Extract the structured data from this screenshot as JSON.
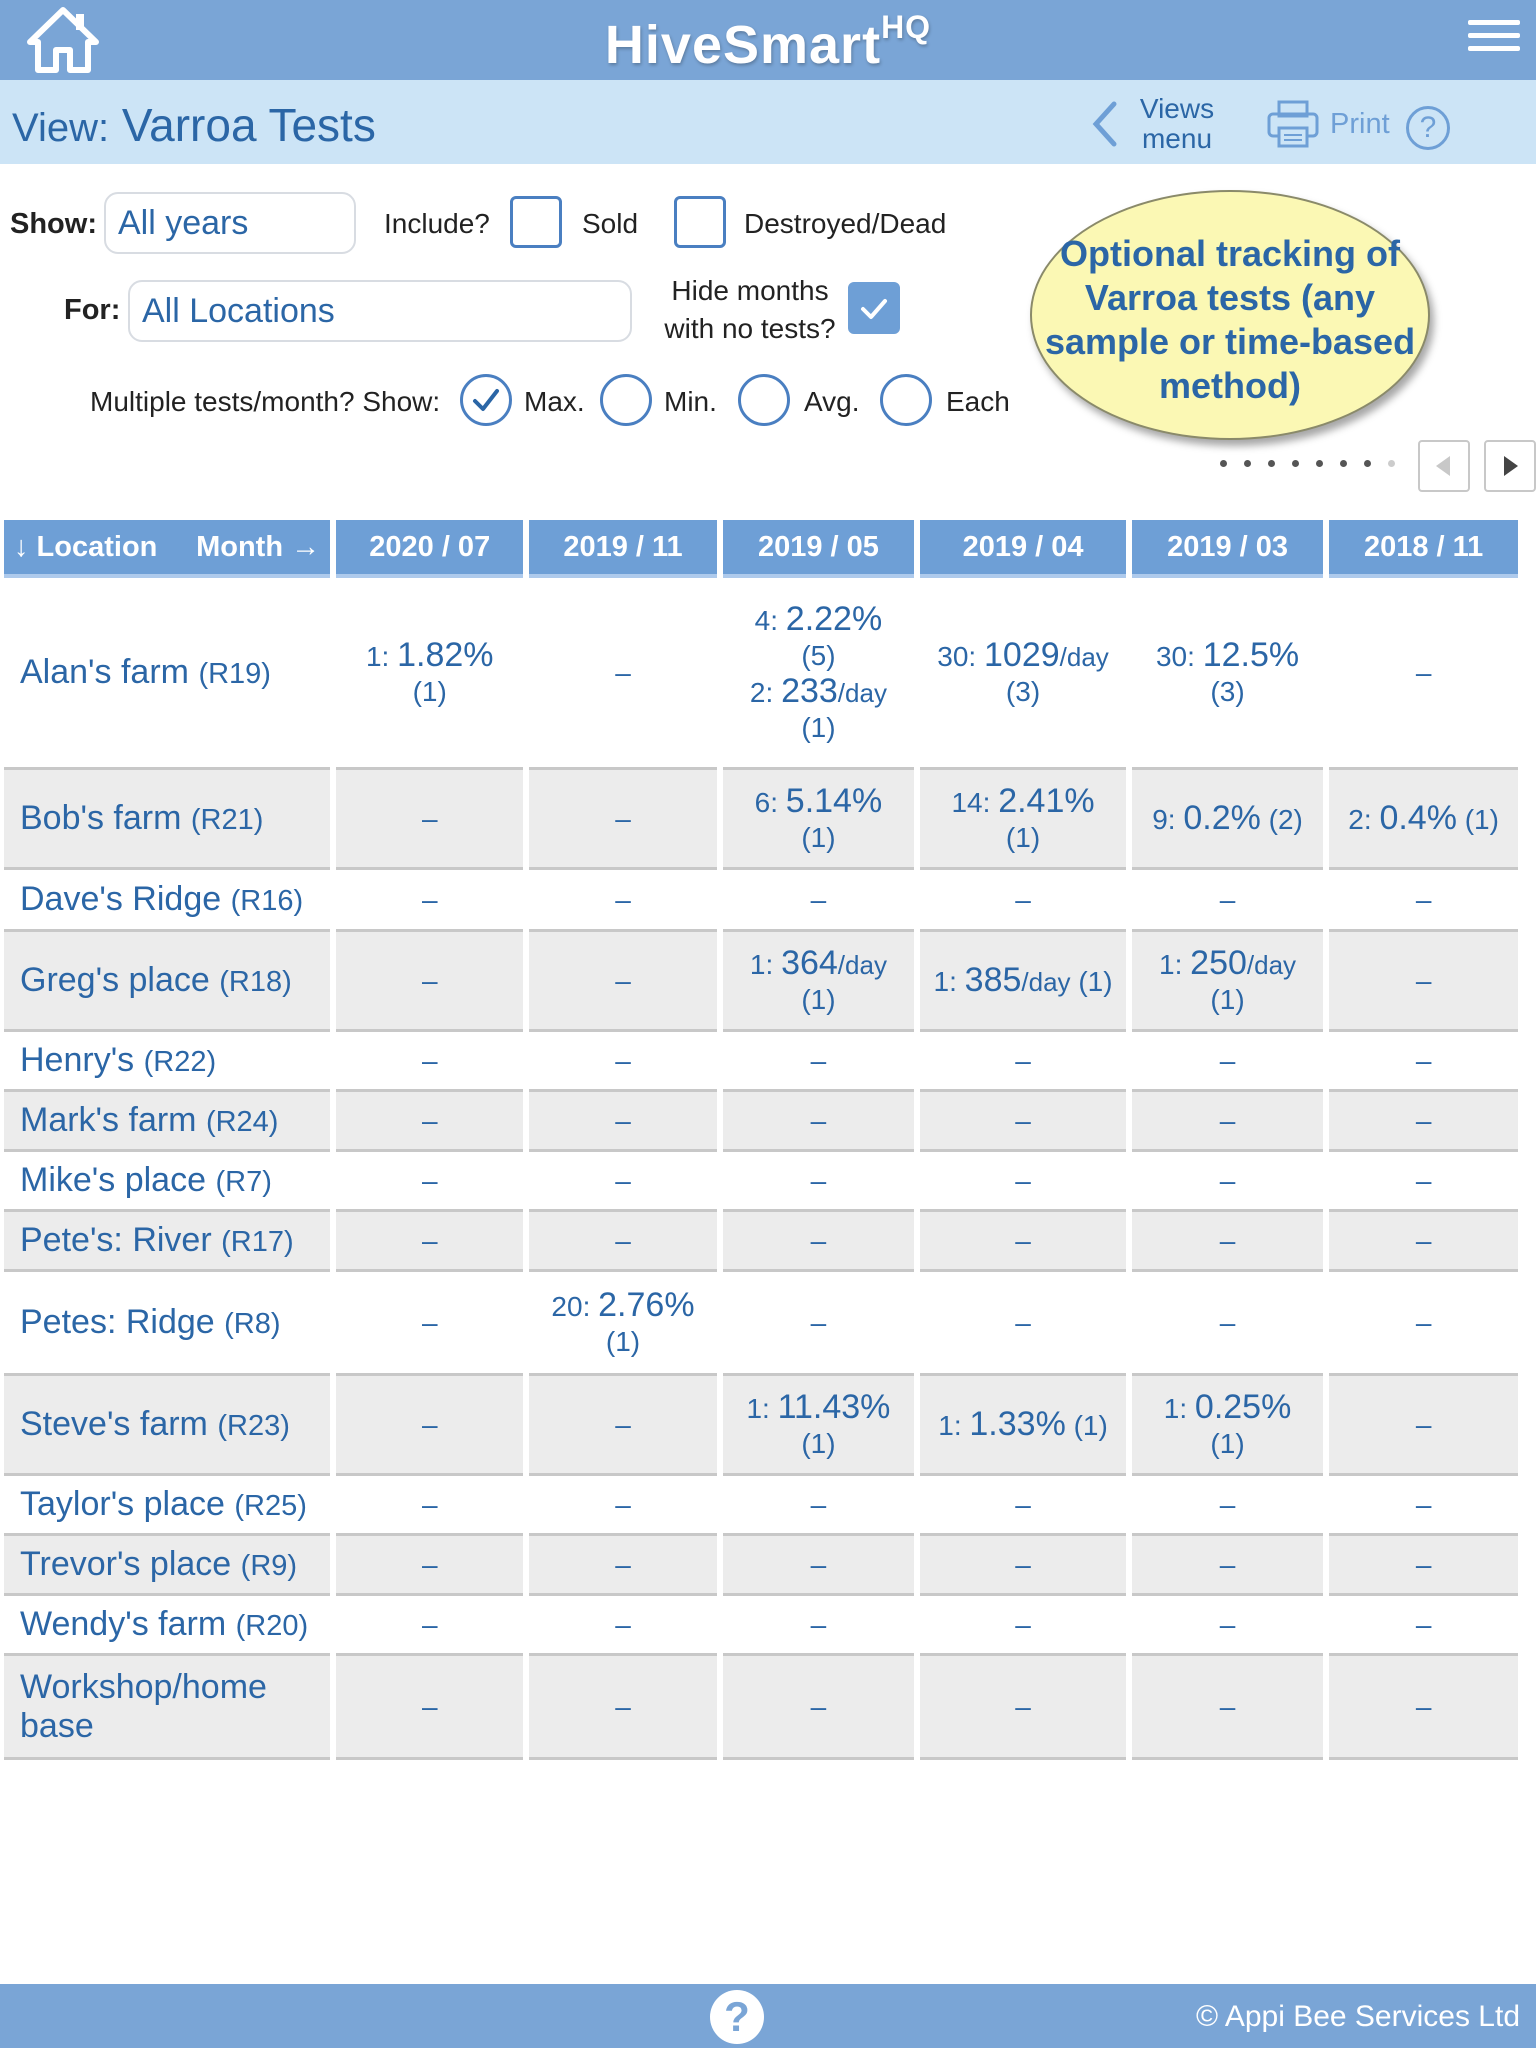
{
  "header": {
    "title": "HiveSmart",
    "title_sup": "HQ",
    "home_icon": "home-icon",
    "menu_icon": "hamburger-icon"
  },
  "view_bar": {
    "prefix": "View:",
    "title": "Varroa Tests",
    "views_menu_label": "Views menu",
    "print_label": "Print",
    "help_label": "?"
  },
  "filters": {
    "show_label": "Show:",
    "show_value": "All years",
    "include_label": "Include?",
    "sold_label": "Sold",
    "sold_checked": false,
    "dead_label": "Destroyed/Dead",
    "dead_checked": false,
    "for_label": "For:",
    "for_value": "All Locations",
    "hide_label": "Hide months with no tests?",
    "hide_checked": true,
    "multi_label": "Multiple tests/month? Show:",
    "multi_options": [
      {
        "label": "Max.",
        "selected": true
      },
      {
        "label": "Min.",
        "selected": false
      },
      {
        "label": "Avg.",
        "selected": false
      },
      {
        "label": "Each",
        "selected": false
      }
    ]
  },
  "callout": {
    "text": "Optional tracking of Varroa tests (any sample or time-based method)"
  },
  "table": {
    "header_location": "↓ Location",
    "header_month": "Month →",
    "months": [
      "2020 / 07",
      "2019 / 11",
      "2019 / 05",
      "2019 / 04",
      "2019 / 03",
      "2018 / 11"
    ],
    "rows": [
      {
        "name": "Alan's farm",
        "code": "(R19)",
        "cells": [
          [
            {
              "n": "1:",
              "v": "1.82%",
              "u": "",
              "c": "(1)"
            }
          ],
          [],
          [
            {
              "n": "4:",
              "v": "2.22%",
              "u": "",
              "c": "(5)"
            },
            {
              "n": "2:",
              "v": "233",
              "u": "/day",
              "c": "(1)"
            }
          ],
          [
            {
              "n": "30:",
              "v": "1029",
              "u": "/day",
              "c": "(3)"
            }
          ],
          [
            {
              "n": "30:",
              "v": "12.5%",
              "u": "",
              "c": "(3)"
            }
          ],
          []
        ]
      },
      {
        "name": "Bob's farm",
        "code": "(R21)",
        "cells": [
          [],
          [],
          [
            {
              "n": "6:",
              "v": "5.14%",
              "u": "",
              "c": "(1)"
            }
          ],
          [
            {
              "n": "14:",
              "v": "2.41%",
              "u": "",
              "c": "(1)"
            }
          ],
          [
            {
              "n": "9:",
              "v": "0.2%",
              "u": "",
              "c": "(2)",
              "inline": true
            }
          ],
          [
            {
              "n": "2:",
              "v": "0.4%",
              "u": "",
              "c": "(1)",
              "inline": true
            }
          ]
        ]
      },
      {
        "name": "Dave's Ridge",
        "code": "(R16)",
        "cells": [
          [],
          [],
          [],
          [],
          [],
          []
        ]
      },
      {
        "name": "Greg's place",
        "code": "(R18)",
        "cells": [
          [],
          [],
          [
            {
              "n": "1:",
              "v": "364",
              "u": "/day",
              "c": "(1)"
            }
          ],
          [
            {
              "n": "1:",
              "v": "385",
              "u": "/day",
              "c": "(1)",
              "inline": true
            }
          ],
          [
            {
              "n": "1:",
              "v": "250",
              "u": "/day",
              "c": "(1)"
            }
          ],
          []
        ]
      },
      {
        "name": "Henry's",
        "code": "(R22)",
        "cells": [
          [],
          [],
          [],
          [],
          [],
          []
        ]
      },
      {
        "name": "Mark's farm",
        "code": "(R24)",
        "cells": [
          [],
          [],
          [],
          [],
          [],
          []
        ]
      },
      {
        "name": "Mike's place",
        "code": "(R7)",
        "cells": [
          [],
          [],
          [],
          [],
          [],
          []
        ]
      },
      {
        "name": "Pete's: River",
        "code": "(R17)",
        "cells": [
          [],
          [],
          [],
          [],
          [],
          []
        ]
      },
      {
        "name": "Petes: Ridge",
        "code": "(R8)",
        "cells": [
          [],
          [
            {
              "n": "20:",
              "v": "2.76%",
              "u": "",
              "c": "(1)"
            }
          ],
          [],
          [],
          [],
          []
        ]
      },
      {
        "name": "Steve's farm",
        "code": "(R23)",
        "cells": [
          [],
          [],
          [
            {
              "n": "1:",
              "v": "11.43%",
              "u": "",
              "c": "(1)"
            }
          ],
          [
            {
              "n": "1:",
              "v": "1.33%",
              "u": "",
              "c": "(1)",
              "inline": true
            }
          ],
          [
            {
              "n": "1:",
              "v": "0.25%",
              "u": "",
              "c": "(1)"
            }
          ],
          []
        ]
      },
      {
        "name": "Taylor's place",
        "code": "(R25)",
        "cells": [
          [],
          [],
          [],
          [],
          [],
          []
        ]
      },
      {
        "name": "Trevor's place",
        "code": "(R9)",
        "cells": [
          [],
          [],
          [],
          [],
          [],
          []
        ]
      },
      {
        "name": "Wendy's farm",
        "code": "(R20)",
        "cells": [
          [],
          [],
          [],
          [],
          [],
          []
        ]
      },
      {
        "name": "Workshop/home base",
        "code": "",
        "cells": [
          [],
          [],
          [],
          [],
          [],
          []
        ]
      }
    ],
    "empty_marker": "–"
  },
  "footer": {
    "help_label": "?",
    "copyright": "© Appi Bee Services Ltd"
  }
}
